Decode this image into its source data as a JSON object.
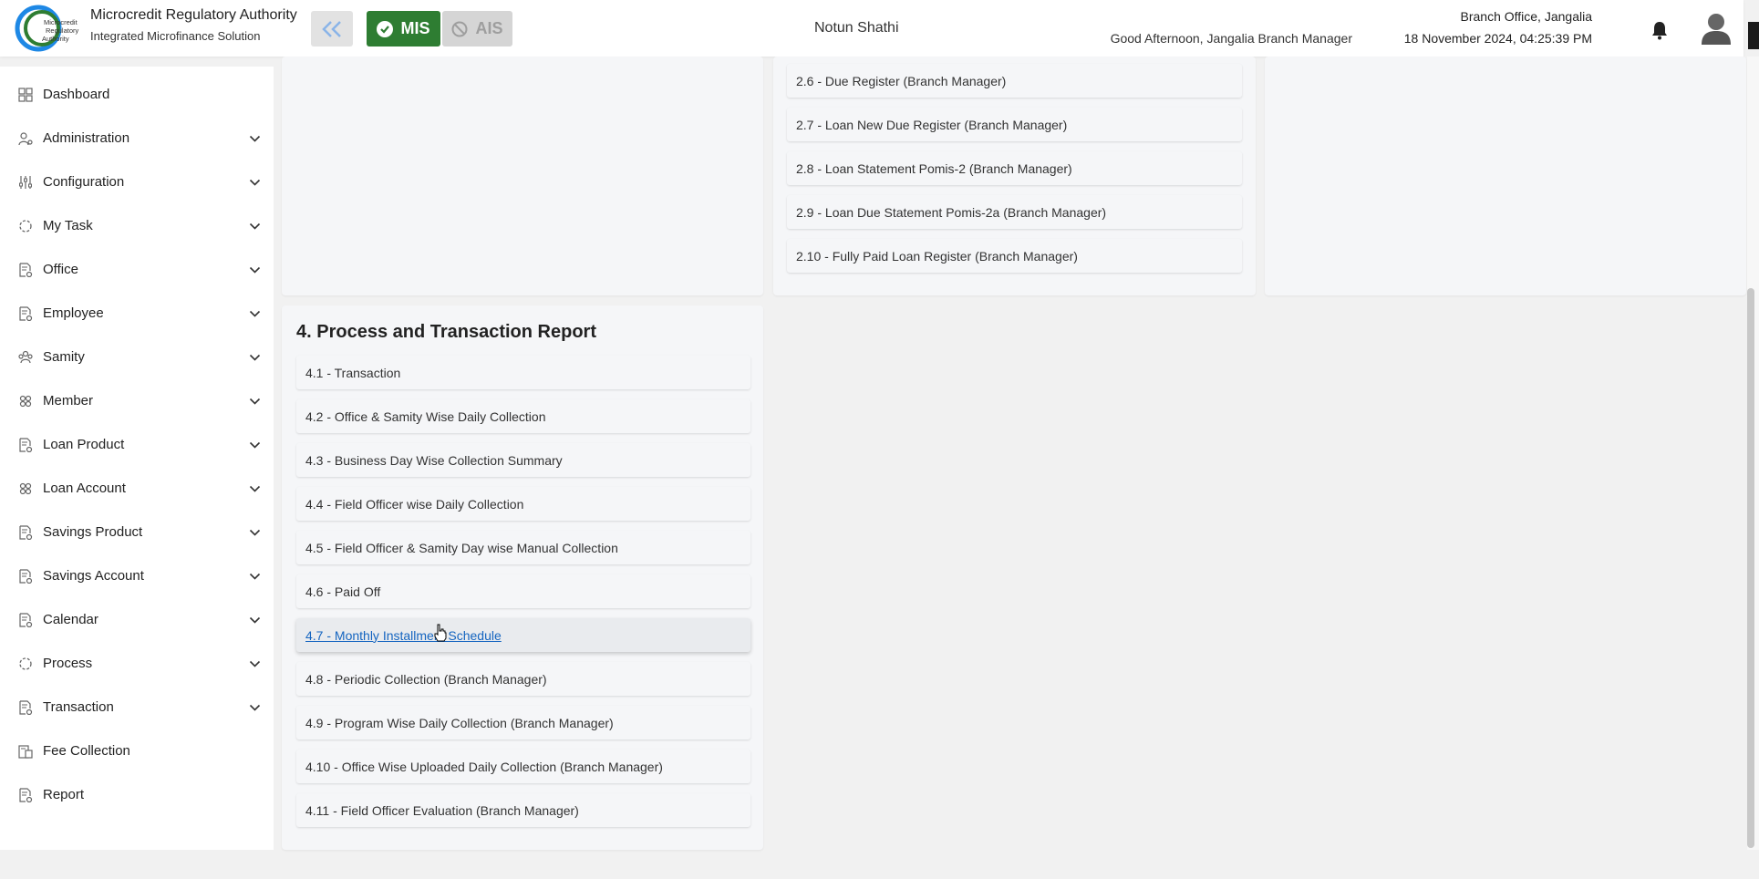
{
  "header": {
    "brand_title": "Microcredit Regulatory Authority",
    "brand_subtitle": "Integrated Microfinance Solution",
    "logo_text": "Microcredit Regulatory Authority",
    "mis_label": "MIS",
    "ais_label": "AIS",
    "center_title": "Notun Shathi",
    "greeting": "Good Afternoon, Jangalia Branch Manager",
    "branch_office": "Branch Office, Jangalia",
    "datetime": "18 November 2024, 04:25:39 PM"
  },
  "sidebar": {
    "items": [
      {
        "label": "Dashboard",
        "icon": "dashboard-icon",
        "expandable": false
      },
      {
        "label": "Administration",
        "icon": "admin-icon",
        "expandable": true
      },
      {
        "label": "Configuration",
        "icon": "sliders-icon",
        "expandable": true
      },
      {
        "label": "My Task",
        "icon": "circle-dashed-icon",
        "expandable": true
      },
      {
        "label": "Office",
        "icon": "document-gear-icon",
        "expandable": true
      },
      {
        "label": "Employee",
        "icon": "document-gear-icon",
        "expandable": true
      },
      {
        "label": "Samity",
        "icon": "group-icon",
        "expandable": true
      },
      {
        "label": "Member",
        "icon": "users-icon",
        "expandable": true
      },
      {
        "label": "Loan Product",
        "icon": "document-gear-icon",
        "expandable": true
      },
      {
        "label": "Loan Account",
        "icon": "users-icon",
        "expandable": true
      },
      {
        "label": "Savings Product",
        "icon": "document-gear-icon",
        "expandable": true
      },
      {
        "label": "Savings Account",
        "icon": "document-gear-icon",
        "expandable": true
      },
      {
        "label": "Calendar",
        "icon": "document-gear-icon",
        "expandable": true
      },
      {
        "label": "Process",
        "icon": "circle-dashed-icon",
        "expandable": true
      },
      {
        "label": "Transaction",
        "icon": "document-gear-icon",
        "expandable": true
      },
      {
        "label": "Fee Collection",
        "icon": "fee-icon",
        "expandable": false
      },
      {
        "label": "Report",
        "icon": "document-gear-icon",
        "expandable": false
      }
    ]
  },
  "loan_reports": {
    "items": [
      "2.6 - Due Register (Branch Manager)",
      "2.7 - Loan New Due Register (Branch Manager)",
      "2.8 - Loan Statement Pomis-2 (Branch Manager)",
      "2.9 - Loan Due Statement Pomis-2a (Branch Manager)",
      "2.10 - Fully Paid Loan Register (Branch Manager)"
    ]
  },
  "process_section": {
    "title": "4. Process and Transaction Report",
    "items": [
      "4.1 - Transaction",
      "4.2 - Office & Samity Wise Daily Collection",
      "4.3 - Business Day Wise Collection Summary",
      "4.4 - Field Officer wise Daily Collection",
      "4.5 - Field Officer & Samity Day wise Manual Collection",
      "4.6 - Paid Off",
      "4.7 - Monthly Installment Schedule",
      "4.8 - Periodic Collection (Branch Manager)",
      "4.9 - Program Wise Daily Collection (Branch Manager)",
      "4.10 - Office Wise Uploaded Daily Collection (Branch Manager)",
      "4.11 - Field Officer Evaluation (Branch Manager)"
    ],
    "hovered_item": "4.7 - Monthly Installment Schedule"
  },
  "colors": {
    "mis_green": "#2e7d32",
    "link_blue": "#1565c0",
    "collapse_arrow": "#8ab4e8"
  }
}
